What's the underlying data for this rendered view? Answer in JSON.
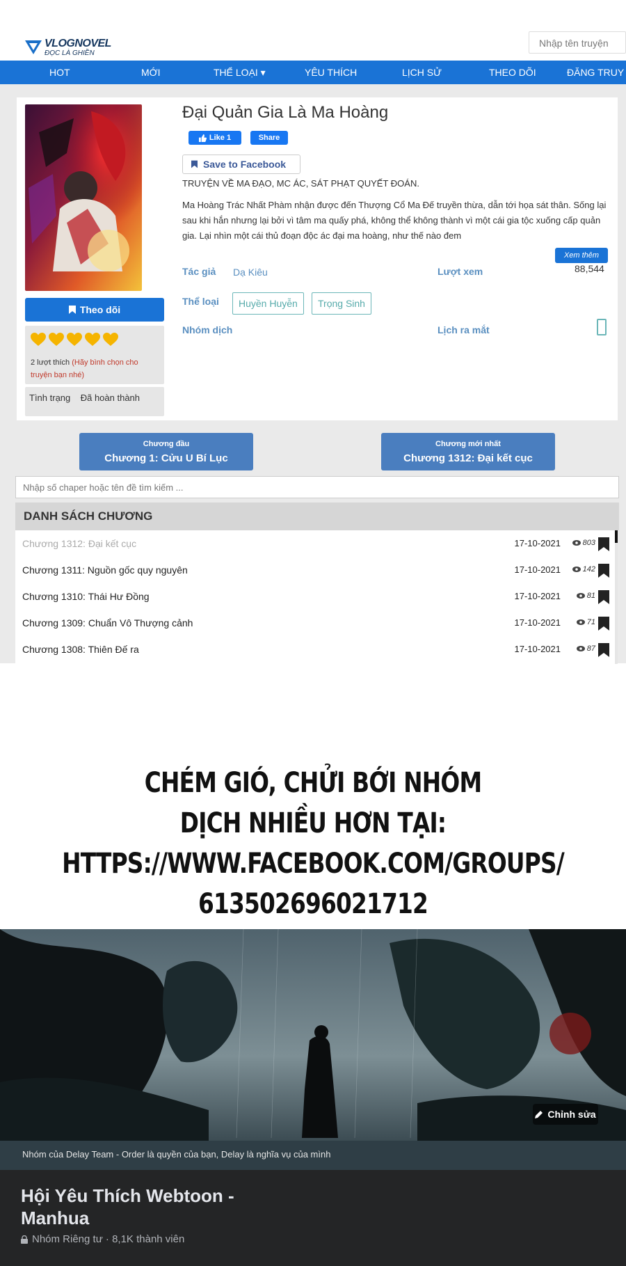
{
  "header": {
    "logo_main": "VLOGNOVEL",
    "logo_sub": "ĐỌC LÀ GHIỀN",
    "search_placeholder": "Nhập tên truyện"
  },
  "nav": {
    "items": [
      {
        "label": "HOT"
      },
      {
        "label": "MỚI"
      },
      {
        "label": "THỂ LOẠI ▾"
      },
      {
        "label": "YÊU THÍCH"
      },
      {
        "label": "LỊCH SỬ"
      },
      {
        "label": "THEO DÕI"
      },
      {
        "label": "ĐĂNG TRUY"
      }
    ]
  },
  "story": {
    "title": "Đại Quản Gia Là Ma Hoàng",
    "like_label": "Like 1",
    "share_label": "Share",
    "save_label": "Save to Facebook",
    "tagline": "TRUYỆN VỀ MA ĐẠO, MC ÁC, SÁT PHẠT QUYẾT ĐOÁN.",
    "description": "Ma Hoàng Trác Nhất Phàm nhận được đến Thượng Cổ Ma Đế truyền thừa, dẫn tới họa sát thân. Sống lại sau khi hắn nhưng lại bởi vì tâm ma quấy phá, không thể không thành vì một cái gia tộc xuống cấp quản gia. Lại nhìn một cái thủ đoạn độc ác đại ma hoàng, như thế nào đem",
    "more_label": "Xem thêm",
    "author_label": "Tác giả",
    "author": "Dạ Kiêu",
    "views_label": "Lượt xem",
    "views": "88,544",
    "genre_label": "Thể loại",
    "genres": [
      "Huyền Huyễn",
      "Trọng Sinh"
    ],
    "group_label": "Nhóm dịch",
    "release_label": "Lịch ra mắt",
    "follow_label": "Theo dõi",
    "rating_hearts": 5,
    "likes_count": "2 lượt thích",
    "likes_prompt": "(Hãy bình chọn cho truyện bạn nhé)",
    "status_label": "Tình trạng",
    "status_value": "Đã hoàn thành"
  },
  "chapters_nav": {
    "first_small": "Chương đầu",
    "first_title": "Chương 1: Cửu U Bí Lục",
    "latest_small": "Chương mới nhất",
    "latest_title": "Chương 1312: Đại kết cục"
  },
  "chapter_search_placeholder": "Nhập số chaper hoặc tên đề tìm kiếm ...",
  "chapter_list": {
    "heading": "DANH SÁCH CHƯƠNG",
    "rows": [
      {
        "name": "Chương 1312: Đại kết cục",
        "date": "17-10-2021",
        "views": "803",
        "read": true
      },
      {
        "name": "Chương 1311: Nguồn gốc quy nguyên",
        "date": "17-10-2021",
        "views": "142",
        "read": false
      },
      {
        "name": "Chương 1310: Thái Hư Đồng",
        "date": "17-10-2021",
        "views": "81",
        "read": false
      },
      {
        "name": "Chương 1309: Chuẩn Vô Thượng cảnh",
        "date": "17-10-2021",
        "views": "71",
        "read": false
      },
      {
        "name": "Chương 1308: Thiên Đế ra",
        "date": "17-10-2021",
        "views": "87",
        "read": false
      }
    ]
  },
  "promo": {
    "line1": "CHÉM GIÓ, CHỬI BỚI NHÓM",
    "line2": "DỊCH NHIỀU HƠN TẠI:",
    "line3": "HTTPS://WWW.FACEBOOK.COM/GROUPS/",
    "line4": "613502696021712"
  },
  "fb_group": {
    "edit_label": "Chỉnh sửa",
    "caption": "Nhóm của Delay Team - Order là quyền của bạn, Delay là nghĩa vụ của mình",
    "title": "Hội Yêu Thích Webtoon - Manhua",
    "subtitle": "Nhóm Riêng tư · 8,1K thành viên"
  },
  "colors": {
    "nav_blue": "#1a73d6",
    "button_blue": "#4a7ebf",
    "label_blue": "#5a8fc0",
    "heart_yellow": "#f5b400",
    "fb_dark": "#242526"
  }
}
